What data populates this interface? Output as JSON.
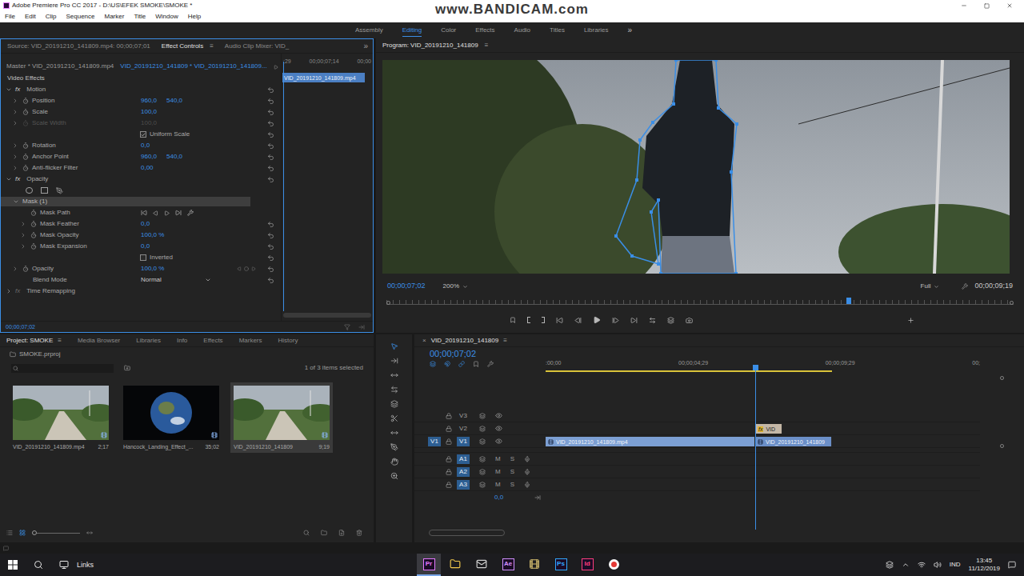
{
  "window": {
    "title": "Adobe Premiere Pro CC 2017 - D:\\US\\EFEK SMOKE\\SMOKE *",
    "watermark": "www.BANDICAM.com"
  },
  "menu": [
    "File",
    "Edit",
    "Clip",
    "Sequence",
    "Marker",
    "Title",
    "Window",
    "Help"
  ],
  "workspaces": [
    {
      "label": "Assembly",
      "selected": false
    },
    {
      "label": "Editing",
      "selected": true
    },
    {
      "label": "Color",
      "selected": false
    },
    {
      "label": "Effects",
      "selected": false
    },
    {
      "label": "Audio",
      "selected": false
    },
    {
      "label": "Titles",
      "selected": false
    },
    {
      "label": "Libraries",
      "selected": false
    }
  ],
  "workspaces_more": "»",
  "effect_controls": {
    "tabs": [
      {
        "label": "Source: VID_20191210_141809.mp4: 00;00;07;01",
        "selected": false
      },
      {
        "label": "Effect Controls",
        "selected": true
      },
      {
        "label": "Audio Clip Mixer: VID_",
        "selected": false
      }
    ],
    "panel_menu": "≡",
    "overflow": "»",
    "master": "Master * VID_20191210_141809.mp4",
    "sequence": "VID_20191210_141809 * VID_20191210_141809...",
    "ruler": [
      ";29",
      "00;00;07;14",
      "00;00"
    ],
    "clip": "VID_20191210_141809.mp4",
    "section": "Video Effects",
    "rows": [
      {
        "kind": "effect",
        "fx": "fx",
        "label": "Motion",
        "expanded": true
      },
      {
        "kind": "property",
        "depth": 1,
        "label": "Position",
        "values": [
          "960,0",
          "540,0"
        ],
        "disabled": false,
        "keyframes": false
      },
      {
        "kind": "property",
        "depth": 1,
        "label": "Scale",
        "values": [
          "100,0"
        ],
        "disabled": false,
        "keyframes": false
      },
      {
        "kind": "property",
        "depth": 1,
        "label": "Scale Width",
        "values": [
          "100,0"
        ],
        "disabled": true,
        "keyframes": false
      },
      {
        "kind": "checkbox",
        "label": "Uniform Scale",
        "checked": true
      },
      {
        "kind": "property",
        "depth": 1,
        "label": "Rotation",
        "values": [
          "0,0"
        ],
        "disabled": false,
        "keyframes": false
      },
      {
        "kind": "property",
        "depth": 1,
        "label": "Anchor Point",
        "values": [
          "960,0",
          "540,0"
        ],
        "disabled": false,
        "keyframes": false
      },
      {
        "kind": "property",
        "depth": 1,
        "label": "Anti-flicker Filter",
        "values": [
          "0,00"
        ],
        "disabled": false,
        "keyframes": false
      },
      {
        "kind": "effect",
        "fx": "fx",
        "label": "Opacity",
        "expanded": true
      },
      {
        "kind": "tools"
      },
      {
        "kind": "mask",
        "label": "Mask (1)",
        "expanded": true,
        "selected": true
      },
      {
        "kind": "maskpath",
        "label": "Mask Path"
      },
      {
        "kind": "property",
        "depth": 2,
        "label": "Mask Feather",
        "values": [
          "0,0"
        ],
        "disabled": false,
        "keyframes": false
      },
      {
        "kind": "property",
        "depth": 2,
        "label": "Mask Opacity",
        "values": [
          "100,0 %"
        ],
        "disabled": false,
        "keyframes": false
      },
      {
        "kind": "property",
        "depth": 2,
        "label": "Mask Expansion",
        "values": [
          "0,0"
        ],
        "disabled": false,
        "keyframes": false
      },
      {
        "kind": "checkbox",
        "label": "Inverted",
        "checked": false
      },
      {
        "kind": "property",
        "depth": 1,
        "label": "Opacity",
        "values": [
          "100,0 %"
        ],
        "disabled": false,
        "keyframes": true
      },
      {
        "kind": "dropdown",
        "label": "Blend Mode",
        "value": "Normal"
      },
      {
        "kind": "effect",
        "fx": "fx",
        "label": "Time Remapping",
        "expanded": false
      }
    ],
    "footer_time": "00;00;07;02"
  },
  "program": {
    "title": "Program: VID_20191210_141809",
    "panel_menu": "≡",
    "timecode": "00;00;07;02",
    "zoom": "200%",
    "quality": "Full",
    "duration": "00;00;09;19",
    "playhead": {
      "level": 0.733
    }
  },
  "project": {
    "tabs": [
      {
        "label": "Project: SMOKE",
        "selected": true
      },
      {
        "label": "Media Browser",
        "selected": false
      },
      {
        "label": "Libraries",
        "selected": false
      },
      {
        "label": "Info",
        "selected": false
      },
      {
        "label": "Effects",
        "selected": false
      },
      {
        "label": "Markers",
        "selected": false
      },
      {
        "label": "History",
        "selected": false
      }
    ],
    "panel_menu": "≡",
    "file": "SMOKE.prproj",
    "selection": "1 of 3 items selected",
    "items": [
      {
        "name": "VID_20191210_141809.mp4",
        "duration": "2;17",
        "kind": "landscape",
        "selected": false
      },
      {
        "name": "Hancock_Landing_Effect_...",
        "duration": "35;02",
        "kind": "space",
        "selected": false
      },
      {
        "name": "VID_20191210_141809",
        "duration": "9;19",
        "kind": "landscape",
        "selected": true
      }
    ]
  },
  "timeline": {
    "tab": "VID_20191210_141809",
    "close": "×",
    "panel_menu": "≡",
    "timecode": "00;00;07;02",
    "ruler": [
      ":00;00",
      "00;00;04;29",
      "00;00;09;29",
      "00;"
    ],
    "playhead": {
      "level": 0.483
    },
    "tracks": [
      {
        "name": "V3",
        "kind": "video",
        "source": "",
        "targeted": false
      },
      {
        "name": "V2",
        "kind": "video",
        "source": "",
        "targeted": false
      },
      {
        "name": "V1",
        "kind": "video",
        "source": "V1",
        "targeted": true
      },
      {
        "name": "A1",
        "kind": "audio",
        "source": "",
        "targeted": true,
        "mute": "M",
        "solo": "S"
      },
      {
        "name": "A2",
        "kind": "audio",
        "source": "",
        "targeted": true,
        "mute": "M",
        "solo": "S"
      },
      {
        "name": "A3",
        "kind": "audio",
        "source": "",
        "targeted": true,
        "mute": "M",
        "solo": "S"
      }
    ],
    "master": "0,0",
    "clips": [
      {
        "track": "V1",
        "label": "VID_20191210_141809.mp4",
        "fx": "",
        "color": "#7c9fd3"
      },
      {
        "track": "V1",
        "label": "VID_20191210_141809",
        "fx": "",
        "color": "#6b8fc8"
      },
      {
        "track": "V2",
        "label": "VID",
        "fx": "fx",
        "color": "#c4b7a6"
      }
    ]
  },
  "taskbar": {
    "links": "Links",
    "apps": [
      {
        "kind": "app",
        "label": "Pr",
        "color": "#e579ff",
        "active": true
      },
      {
        "kind": "folder",
        "label": "",
        "color": "#f2c94c",
        "active": false
      },
      {
        "kind": "mail",
        "label": "",
        "color": "#d0d0d0",
        "active": false
      },
      {
        "kind": "app",
        "label": "Ae",
        "color": "#d291ff",
        "active": false
      },
      {
        "kind": "media",
        "label": "",
        "color": "#d8c070",
        "active": false
      },
      {
        "kind": "app",
        "label": "Ps",
        "color": "#31a8ff",
        "active": false
      },
      {
        "kind": "app",
        "label": "Id",
        "color": "#ff3d7f",
        "active": false
      },
      {
        "kind": "record",
        "label": "",
        "color": "#e53935",
        "active": false
      }
    ],
    "language": "IND",
    "time": "13:45",
    "date": "11/12/2019"
  }
}
